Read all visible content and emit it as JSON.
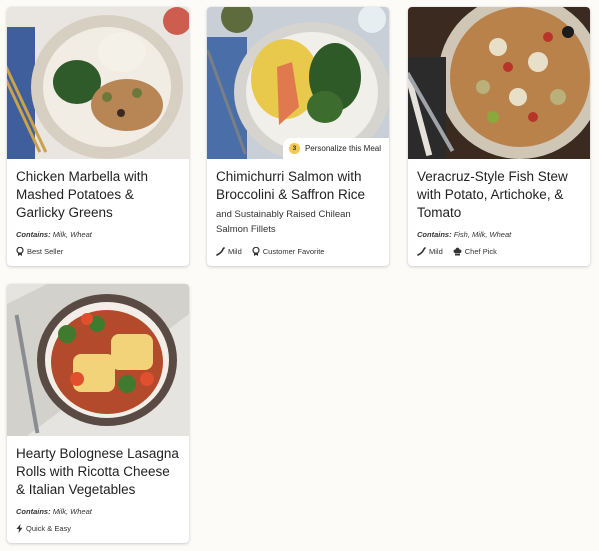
{
  "meals": [
    {
      "title": "Chicken Marbella with Mashed Potatoes & Garlicky Greens",
      "subtitle": "",
      "contains_label": "Contains:",
      "contains": "Milk, Wheat",
      "tags": [
        {
          "icon": "best-seller-icon",
          "label": "Best Seller"
        }
      ]
    },
    {
      "title": "Chimichurri Salmon with Broccolini & Saffron Rice",
      "subtitle": "and Sustainably Raised Chilean Salmon Fillets",
      "contains_label": "",
      "contains": "",
      "personalize_count": "3",
      "personalize_label": "Personalize this Meal",
      "tags": [
        {
          "icon": "mild-pepper-icon",
          "label": "Mild"
        },
        {
          "icon": "customer-favorite-icon",
          "label": "Customer Favorite"
        }
      ]
    },
    {
      "title": "Veracruz-Style Fish Stew with Potato, Artichoke, & Tomato",
      "subtitle": "",
      "contains_label": "Contains:",
      "contains": "Fish, Milk, Wheat",
      "tags": [
        {
          "icon": "mild-pepper-icon",
          "label": "Mild"
        },
        {
          "icon": "chef-hat-icon",
          "label": "Chef Pick"
        }
      ]
    },
    {
      "title": "Hearty Bolognese Lasagna Rolls with Ricotta Cheese & Italian Vegetables",
      "subtitle": "",
      "contains_label": "Contains:",
      "contains": "Milk, Wheat",
      "tags": [
        {
          "icon": "lightning-icon",
          "label": "Quick & Easy"
        }
      ]
    }
  ]
}
